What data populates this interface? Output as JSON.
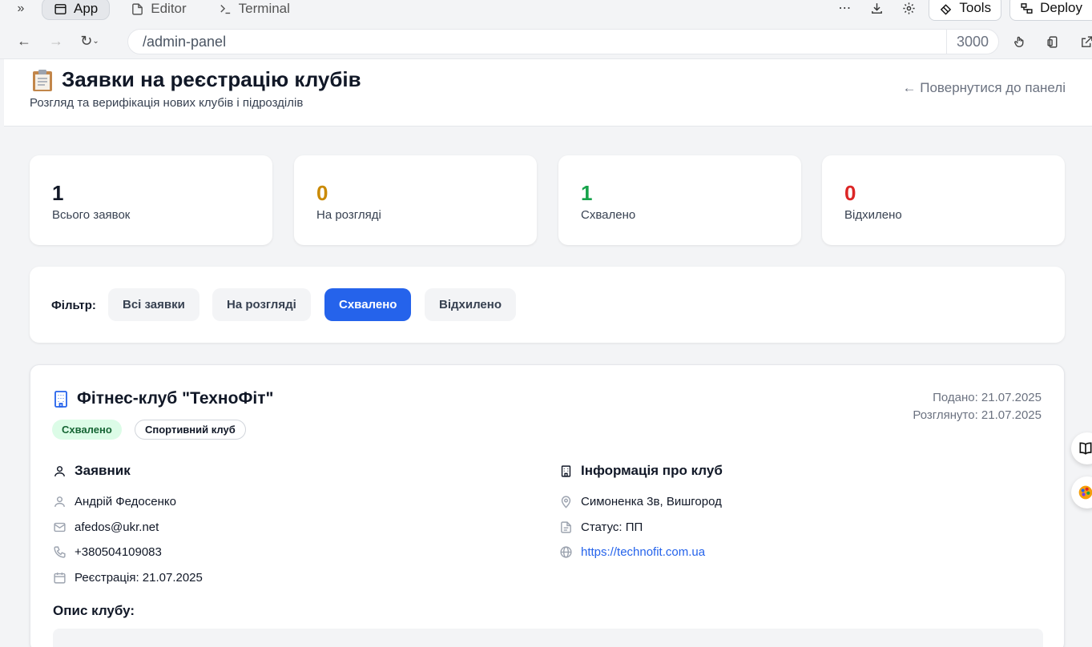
{
  "ide": {
    "tabs": [
      {
        "label": "App",
        "icon": "window-icon"
      },
      {
        "label": "Editor",
        "icon": "file-icon"
      },
      {
        "label": "Terminal",
        "icon": "terminal-icon"
      }
    ],
    "tools_label": "Tools",
    "deploy_label": "Deploy"
  },
  "browser": {
    "url": "/admin-panel",
    "port": "3000"
  },
  "header": {
    "title": "Заявки на реєстрацію клубів",
    "subtitle": "Розгляд та верифікація нових клубів і підрозділів",
    "back_link": "← Повернутися до панелі"
  },
  "stats": [
    {
      "value": "1",
      "label": "Всього заявок",
      "color": "#111827"
    },
    {
      "value": "0",
      "label": "На розгляді",
      "color": "#ca8a04"
    },
    {
      "value": "1",
      "label": "Схвалено",
      "color": "#16a34a"
    },
    {
      "value": "0",
      "label": "Відхилено",
      "color": "#dc2626"
    }
  ],
  "filter": {
    "label": "Фільтр:",
    "options": [
      "Всі заявки",
      "На розгляді",
      "Схвалено",
      "Відхилено"
    ],
    "selected": "Схвалено"
  },
  "club": {
    "name": "Фітнес-клуб \"ТехноФіт\"",
    "status_badge": "Схвалено",
    "type_badge": "Спортивний клуб",
    "submitted": "Подано: 21.07.2025",
    "reviewed": "Розглянуто: 21.07.2025",
    "applicant": {
      "heading": "Заявник",
      "name": "Андрій Федосенко",
      "email": "afedos@ukr.net",
      "phone": "+380504109083",
      "registration": "Реєстрація: 21.07.2025"
    },
    "info": {
      "heading": "Інформація про клуб",
      "address": "Симоненка 3в, Вишгород",
      "status": "Статус: ПП",
      "website": "https://technofit.com.ua"
    },
    "description_heading": "Опис клубу:"
  }
}
